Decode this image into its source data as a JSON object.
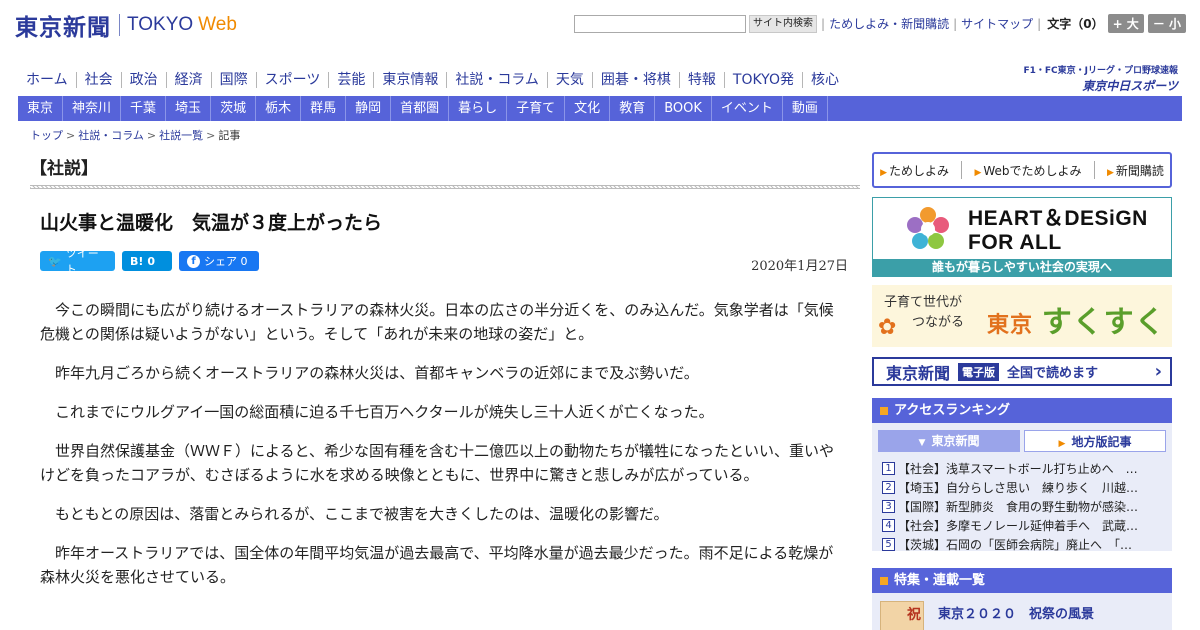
{
  "header": {
    "logo_jp": "東京新聞",
    "logo_tokyo": "TOKYO",
    "logo_web": "Web",
    "search_placeholder": "",
    "search_button": "サイト内検索",
    "link_trial": "ためしよみ・新聞購読",
    "link_sitemap": "サイトマップ",
    "font_size_label": "文字（0）",
    "font_larger": "+ 大",
    "font_smaller": "－ 小"
  },
  "main_nav": [
    "ホーム",
    "社会",
    "政治",
    "経済",
    "国際",
    "スポーツ",
    "芸能",
    "東京情報",
    "社説・コラム",
    "天気",
    "囲碁・将棋",
    "特報",
    "TOKYO発",
    "核心"
  ],
  "chunichi": {
    "tagline": "F1・FC東京・Jリーグ・プロ野球速報",
    "logo": "東京中日スポーツ"
  },
  "sub_nav": [
    "東京",
    "神奈川",
    "千葉",
    "埼玉",
    "茨城",
    "栃木",
    "群馬",
    "静岡",
    "首都圏",
    "暮らし",
    "子育て",
    "文化",
    "教育",
    "BOOK",
    "イベント",
    "動画"
  ],
  "breadcrumb": [
    "トップ",
    "社説・コラム",
    "社説一覧",
    "記事"
  ],
  "article": {
    "section": "【社説】",
    "headline": "山火事と温暖化　気温が３度上がったら",
    "tweet_label": "ツイート",
    "hatena_label": "B!",
    "hatena_count": "0",
    "share_label": "シェア",
    "share_count": "0",
    "date": "2020年1月27日",
    "paragraphs": [
      "今この瞬間にも広がり続けるオーストラリアの森林火災。日本の広さの半分近くを、のみ込んだ。気象学者は「気候危機との関係は疑いようがない」という。そして「あれが未来の地球の姿だ」と。",
      "昨年九月ごろから続くオーストラリアの森林火災は、首都キャンベラの近郊にまで及ぶ勢いだ。",
      "これまでにウルグアイ一国の総面積に迫る千七百万ヘクタールが焼失し三十人近くが亡くなった。",
      "世界自然保護基金（ＷＷＦ）によると、希少な固有種を含む十二億匹以上の動物たちが犠牲になったといい、重いやけどを負ったコアラが、むさぼるように水を求める映像とともに、世界中に驚きと悲しみが広がっている。",
      "もともとの原因は、落雷とみられるが、ここまで被害を大きくしたのは、温暖化の影響だ。",
      "昨年オーストラリアでは、国全体の年間平均気温が過去最高で、平均降水量が過去最少だった。雨不足による乾燥が森林火災を悪化させている。"
    ]
  },
  "sidebar": {
    "trial": [
      "ためしよみ",
      "Webでためしよみ",
      "新聞購読"
    ],
    "heart_title_line1": "HEART＆DESiGN",
    "heart_title_line2": "FOR ALL",
    "heart_band": "誰もが暮らしやすい社会の実現へ",
    "suku_line1": "子育て世代が",
    "suku_line2": "つながる",
    "suku_tokyo": "東京",
    "suku_name": "すくすく",
    "eban_logo": "東京新聞",
    "eban_tag": "電子版",
    "eban_text": "全国で読めます",
    "ranking_title": "アクセスランキング",
    "ranking_tab_active": "東京新聞",
    "ranking_tab_inactive": "地方版記事",
    "ranking": [
      {
        "num": "1",
        "text": "【社会】浅草スマートボール打ち止めへ　…"
      },
      {
        "num": "2",
        "text": "【埼玉】自分らしさ思い　練り歩く　川越…"
      },
      {
        "num": "3",
        "text": "【国際】新型肺炎　食用の野生動物が感染…"
      },
      {
        "num": "4",
        "text": "【社会】多摩モノレール延伸着手へ　武蔵…"
      },
      {
        "num": "5",
        "text": "【茨城】石岡の「医師会病院」廃止へ　「…"
      }
    ],
    "feature_title": "特集・連載一覧",
    "feature_item": "東京２０２０　祝祭の風景",
    "feature_thumb": "祝"
  }
}
